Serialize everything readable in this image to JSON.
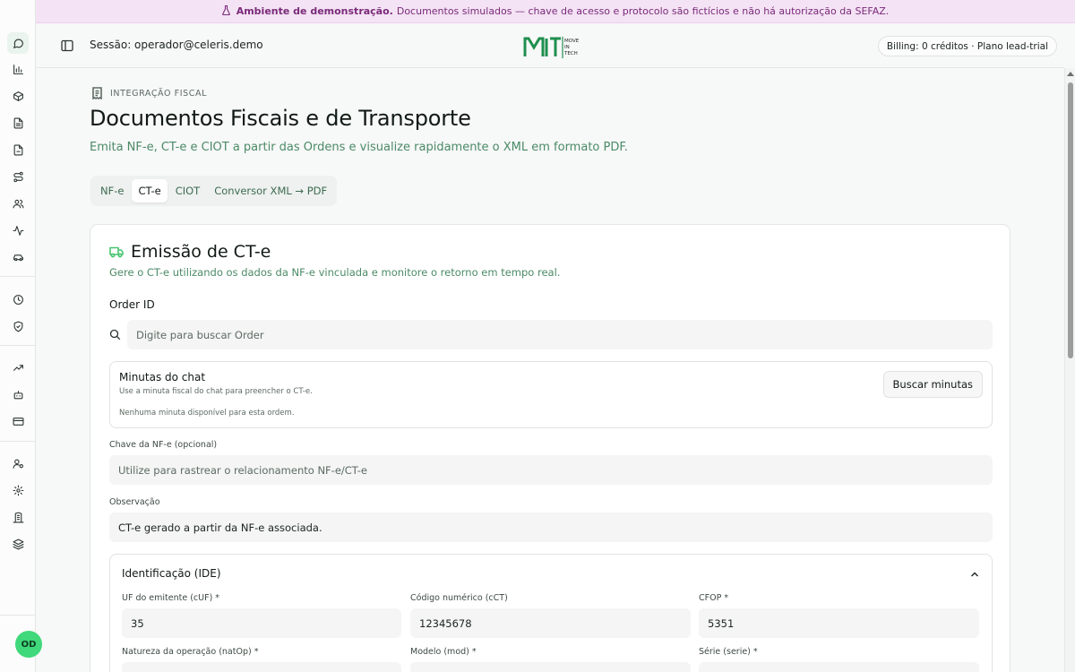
{
  "banner": {
    "strong": "Ambiente de demonstração.",
    "text": "Documentos simulados — chave de acesso e protocolo são fictícios e não há autorização da SEFAZ."
  },
  "header": {
    "session": "Sessão: operador@celeris.demo",
    "billing": "Billing: 0 créditos · Plano lead-trial",
    "logo": {
      "mark": "MIT",
      "words": [
        "MOVE",
        "IN",
        "TECH"
      ]
    }
  },
  "rail": {
    "items": [
      "chat-icon",
      "bar-chart-icon",
      "box-icon",
      "file-text-icon",
      "file-icon",
      "route-icon",
      "users-icon",
      "activity-icon",
      "car-icon",
      "clock-icon",
      "shield-check-icon",
      "trending-up-icon",
      "bot-icon",
      "credit-card-icon",
      "user-cog-icon",
      "settings-icon",
      "building-icon",
      "layers-icon"
    ],
    "active": "chat-icon"
  },
  "user": {
    "initials": "OD"
  },
  "page": {
    "eyebrow": "INTEGRAÇÃO FISCAL",
    "title": "Documentos Fiscais e de Transporte",
    "subtitle": "Emita NF-e, CT-e e CIOT a partir das Ordens e visualize rapidamente o XML em formato PDF."
  },
  "tabs": [
    "NF-e",
    "CT-e",
    "CIOT",
    "Conversor XML → PDF"
  ],
  "active_tab": "CT-e",
  "cte": {
    "title": "Emissão de CT-e",
    "subtitle": "Gere o CT-e utilizando os dados da NF-e vinculada e monitore o retorno em tempo real.",
    "order_label": "Order ID",
    "order_placeholder": "Digite para buscar Order",
    "minutas": {
      "title": "Minutas do chat",
      "subtitle": "Use a minuta fiscal do chat para preencher o CT-e.",
      "empty": "Nenhuma minuta disponível para esta ordem.",
      "button": "Buscar minutas"
    },
    "nfe_key": {
      "label": "Chave da NF-e (opcional)",
      "placeholder": "Utilize para rastrear o relacionamento NF-e/CT-e"
    },
    "obs": {
      "label": "Observação",
      "value": "CT-e gerado a partir da NF-e associada."
    },
    "ide": {
      "title": "Identificação (IDE)",
      "fields": [
        {
          "label": "UF do emitente (cUF) *",
          "value": "35"
        },
        {
          "label": "Código numérico (cCT)",
          "value": "12345678"
        },
        {
          "label": "CFOP *",
          "value": "5351"
        },
        {
          "label": "Natureza da operação (natOp) *",
          "value": ""
        },
        {
          "label": "Modelo (mod) *",
          "value": ""
        },
        {
          "label": "Série (serie) *",
          "value": ""
        }
      ]
    }
  },
  "colors": {
    "accent": "#45c46f",
    "accent_text": "#4b8a66",
    "banner_bg": "#f4e3f4",
    "banner_text": "#7a2a7a"
  }
}
